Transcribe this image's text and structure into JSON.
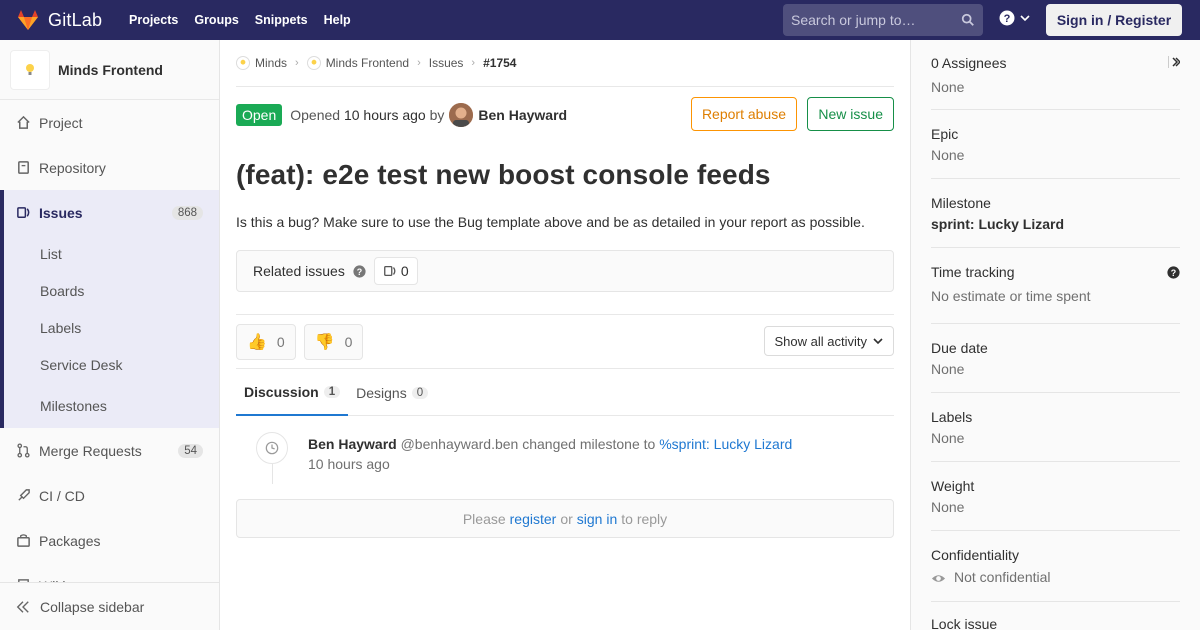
{
  "navbar": {
    "brand": "GitLab",
    "links": [
      "Projects",
      "Groups",
      "Snippets",
      "Help"
    ],
    "search_placeholder": "Search or jump to…",
    "sign_in": "Sign in / Register"
  },
  "sidebar": {
    "project_name": "Minds Frontend",
    "items": [
      {
        "label": "Project",
        "icon": "home-icon"
      },
      {
        "label": "Repository",
        "icon": "doc-icon"
      },
      {
        "label": "Issues",
        "icon": "issues-icon",
        "badge": "868",
        "active": true
      },
      {
        "label": "Merge Requests",
        "icon": "merge-request-icon",
        "badge": "54"
      },
      {
        "label": "CI / CD",
        "icon": "rocket-icon"
      },
      {
        "label": "Packages",
        "icon": "package-icon"
      },
      {
        "label": "Wiki",
        "icon": "book-icon"
      }
    ],
    "sub_items": [
      "List",
      "Boards",
      "Labels",
      "Service Desk",
      "Milestones"
    ],
    "collapse": "Collapse sidebar"
  },
  "breadcrumb": {
    "items": [
      "Minds",
      "Minds Frontend",
      "Issues"
    ],
    "current": "#1754"
  },
  "issue": {
    "status": "Open",
    "opened_prefix": "Opened",
    "opened_when": "10 hours ago",
    "opened_by": "by",
    "author": "Ben Hayward",
    "report_abuse": "Report abuse",
    "new_issue": "New issue",
    "title": "(feat): e2e test new boost console feeds",
    "description": "Is this a bug? Make sure to use the Bug template above and be as detailed in your report as possible."
  },
  "related": {
    "label": "Related issues",
    "count": "0"
  },
  "awards": {
    "thumbs_up": "0",
    "thumbs_down": "0",
    "activity_filter": "Show all activity"
  },
  "tabs": [
    {
      "label": "Discussion",
      "count": "1"
    },
    {
      "label": "Designs",
      "count": "0"
    }
  ],
  "note": {
    "author": "Ben Hayward",
    "handle": "@benhayward.ben",
    "action": "changed milestone to",
    "milestone_link": "%sprint: Lucky Lizard",
    "time": "10 hours ago"
  },
  "reply": {
    "please": "Please",
    "register": "register",
    "or": "or",
    "sign_in": "sign in",
    "to_reply": "to reply"
  },
  "right_sidebar": {
    "assignees_title": "0 Assignees",
    "assignees_value": "None",
    "epic_title": "Epic",
    "epic_value": "None",
    "milestone_title": "Milestone",
    "milestone_value": "sprint: Lucky Lizard",
    "time_tracking_title": "Time tracking",
    "time_tracking_value": "No estimate or time spent",
    "due_date_title": "Due date",
    "due_date_value": "None",
    "labels_title": "Labels",
    "labels_value": "None",
    "weight_title": "Weight",
    "weight_value": "None",
    "confidentiality_title": "Confidentiality",
    "confidentiality_value": "Not confidential",
    "lock_title": "Lock issue"
  },
  "colors": {
    "navbar": "#292961",
    "open_badge": "#1aaa55",
    "link": "#1f78d1",
    "report_abuse": "#fc9403",
    "new_issue": "#168f48"
  }
}
